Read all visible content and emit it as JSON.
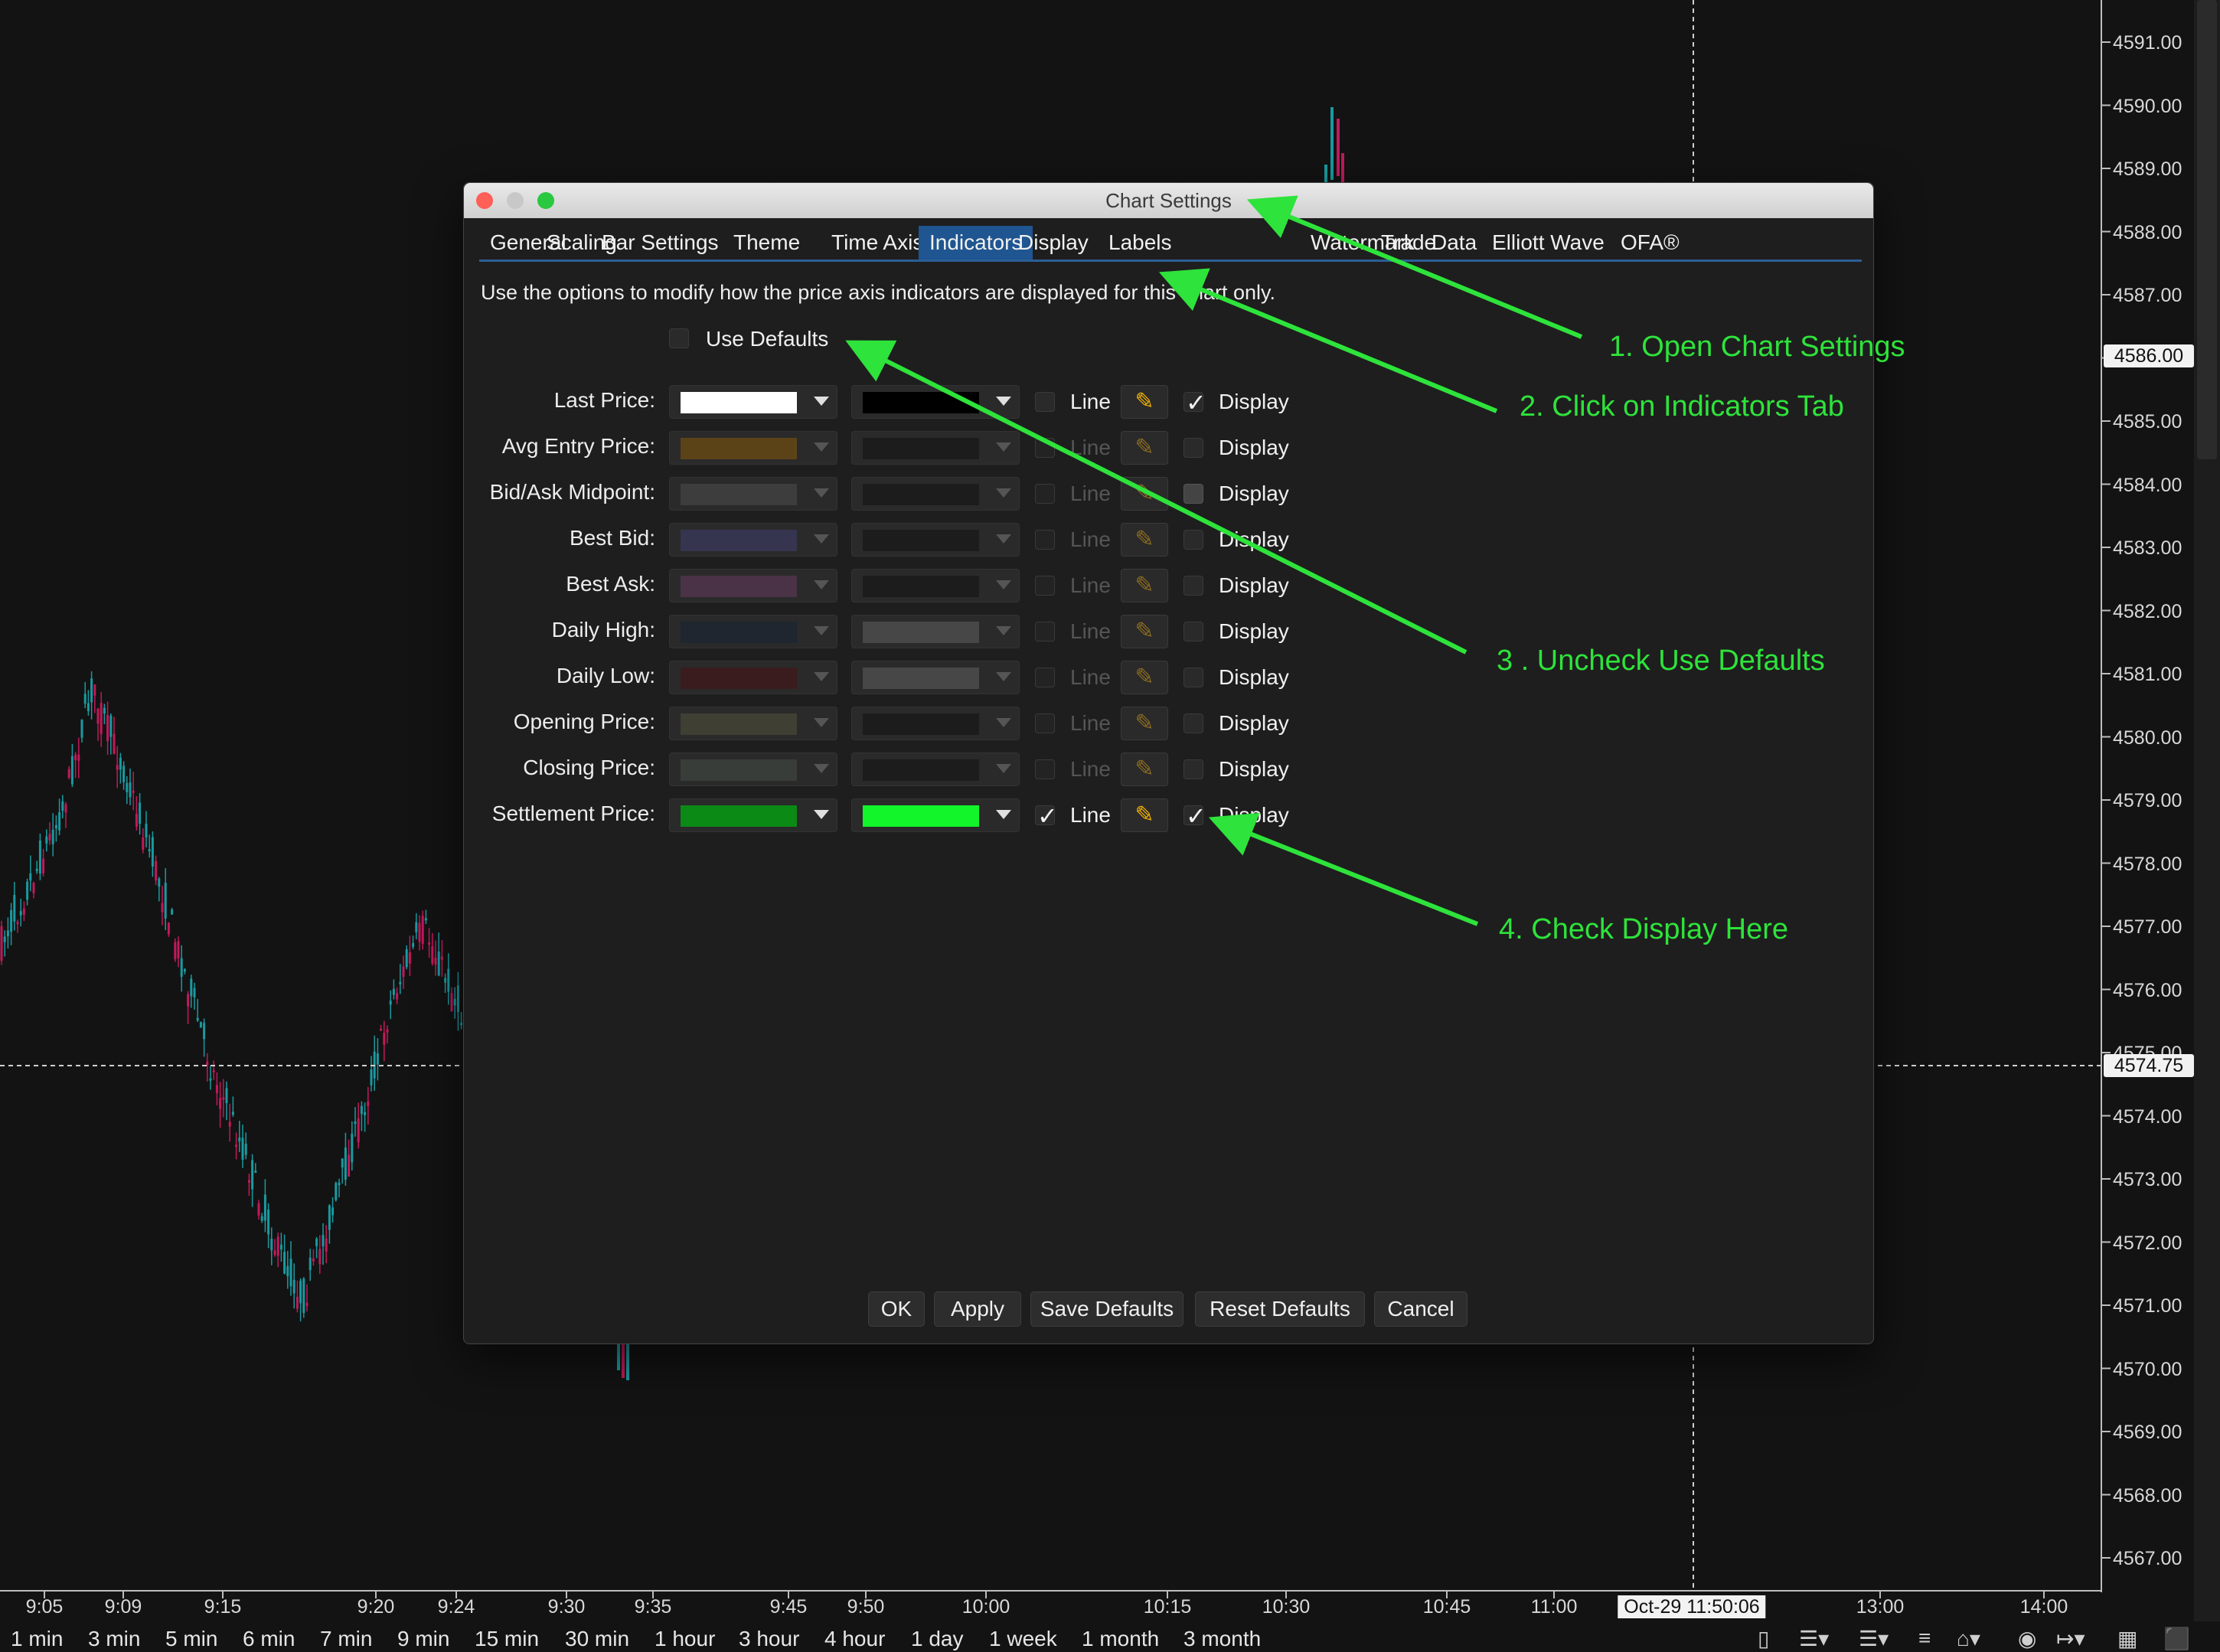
{
  "price_axis": {
    "labels": [
      "4591.00",
      "4590.00",
      "4589.00",
      "4588.00",
      "4587.00",
      "4586.00",
      "4585.00",
      "4584.00",
      "4583.00",
      "4582.00",
      "4581.00",
      "4580.00",
      "4579.00",
      "4578.00",
      "4577.00",
      "4576.00",
      "4575.00",
      "4574.00",
      "4573.00",
      "4572.00",
      "4571.00",
      "4570.00",
      "4569.00",
      "4568.00",
      "4567.00"
    ],
    "current_price_badge": "4586.00",
    "crosshair_price_badge": "4574.75"
  },
  "time_axis": {
    "labels": [
      "9:05",
      "9:09",
      "9:15",
      "9:20",
      "9:24",
      "9:30",
      "9:35",
      "9:45",
      "9:50",
      "10:00",
      "10:15",
      "10:30",
      "10:45",
      "11:00",
      "13:00",
      "14:00"
    ],
    "crosshair_time_badge": "Oct-29 11:50:06"
  },
  "intervals": [
    "1 min",
    "3 min",
    "5 min",
    "6 min",
    "7 min",
    "9 min",
    "15 min",
    "30 min",
    "1 hour",
    "3 hour",
    "4 hour",
    "1 day",
    "1 week",
    "1 month",
    "3 month"
  ],
  "toolbar_icons": [
    "clipboard-icon",
    "align-left-icon",
    "align-left-icon",
    "menu-icon",
    "home-chart-icon",
    "eye-icon",
    "scale-icon",
    "calendar-icon",
    "stack-icon"
  ],
  "colors": {
    "accent": "#1f5590",
    "annotation": "#2ee33b",
    "up_candle": "#1a9aa0",
    "down_candle": "#c2195b"
  },
  "dialog": {
    "title": "Chart Settings",
    "tabs": [
      "General",
      "Scaling",
      "Bar Settings",
      "Theme",
      "Time Axis",
      "Indicators",
      "Display",
      "Labels",
      "Watermark",
      "Trade",
      "Data",
      "Elliott Wave",
      "OFA®"
    ],
    "active_tab": "Indicators",
    "description": "Use the options to modify how the price axis indicators are displayed for this chart only.",
    "use_defaults_label": "Use Defaults",
    "use_defaults_checked": false,
    "line_label": "Line",
    "display_label": "Display",
    "rows": [
      {
        "label": "Last Price:",
        "color1": "#ffffff",
        "color2": "#000000",
        "line": false,
        "display": true,
        "enabled": true
      },
      {
        "label": "Avg Entry Price:",
        "color1": "#5c4317",
        "color2": "#1c1c1c",
        "line": false,
        "display": false,
        "enabled": false
      },
      {
        "label": "Bid/Ask Midpoint:",
        "color1": "#3d3d3d",
        "color2": "#1c1c1c",
        "line": false,
        "display": false,
        "enabled": false
      },
      {
        "label": "Best Bid:",
        "color1": "#35354f",
        "color2": "#1c1c1c",
        "line": false,
        "display": false,
        "enabled": false
      },
      {
        "label": "Best Ask:",
        "color1": "#4a3346",
        "color2": "#1c1c1c",
        "line": false,
        "display": false,
        "enabled": false
      },
      {
        "label": "Daily High:",
        "color1": "#1f2630",
        "color2": "#474747",
        "line": false,
        "display": false,
        "enabled": false
      },
      {
        "label": "Daily Low:",
        "color1": "#3a1c1e",
        "color2": "#474747",
        "line": false,
        "display": false,
        "enabled": false
      },
      {
        "label": "Opening Price:",
        "color1": "#3f3f34",
        "color2": "#1c1c1c",
        "line": false,
        "display": false,
        "enabled": false
      },
      {
        "label": "Closing Price:",
        "color1": "#393d39",
        "color2": "#1c1c1c",
        "line": false,
        "display": false,
        "enabled": false
      },
      {
        "label": "Settlement Price:",
        "color1": "#0b8a16",
        "color2": "#11f52a",
        "line": true,
        "display": true,
        "enabled": true
      }
    ],
    "buttons": [
      "OK",
      "Apply",
      "Save Defaults",
      "Reset Defaults",
      "Cancel"
    ]
  },
  "annotations": [
    "1. Open Chart Settings",
    "2. Click on Indicators Tab",
    "3 . Uncheck Use Defaults",
    "4. Check Display Here"
  ]
}
